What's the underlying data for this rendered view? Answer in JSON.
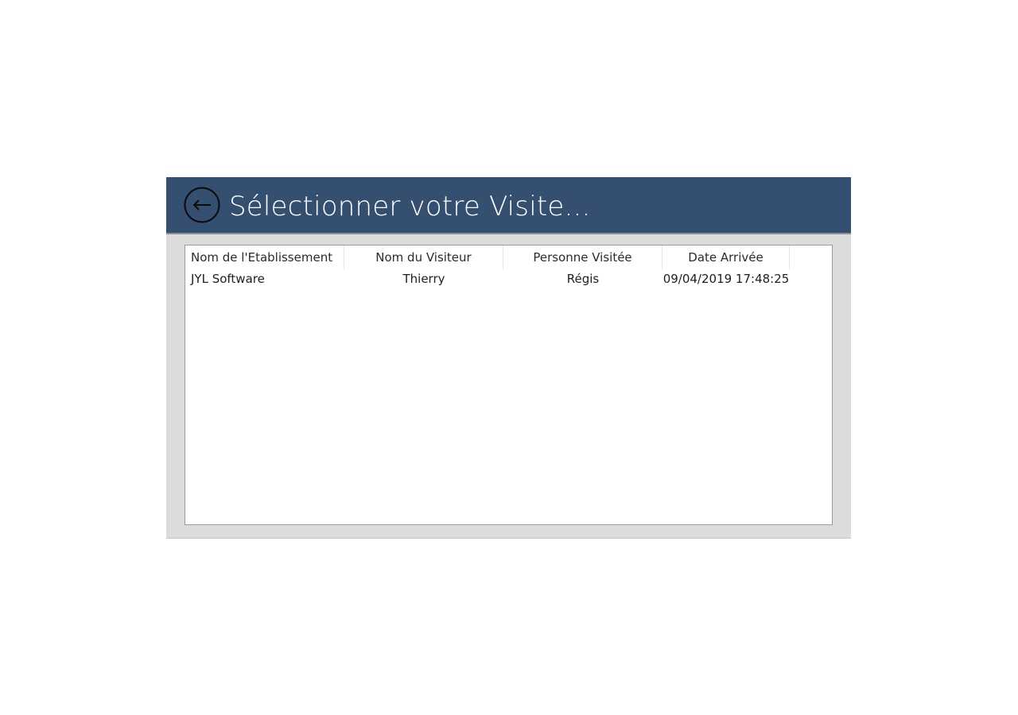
{
  "header": {
    "title": "Sélectionner votre Visite..."
  },
  "icons": {
    "back": "back-arrow-circle-icon"
  },
  "colors": {
    "header_bg": "#354f70",
    "dialog_bg": "#dcdcdc"
  },
  "table": {
    "columns": [
      "Nom de l'Etablissement",
      "Nom du Visiteur",
      "Personne Visitée",
      "Date Arrivée"
    ],
    "rows": [
      [
        "JYL Software",
        "Thierry",
        "Régis",
        "09/04/2019 17:48:25"
      ]
    ]
  }
}
